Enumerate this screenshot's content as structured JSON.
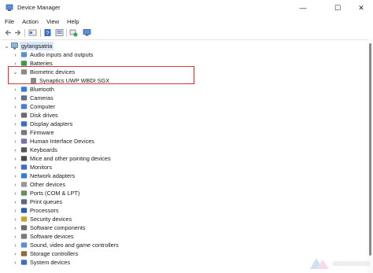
{
  "window": {
    "title": "Device Manager",
    "minimize_glyph": "—",
    "maximize_glyph": "☐",
    "close_glyph": "✕"
  },
  "menu": {
    "items": [
      "File",
      "Action",
      "View",
      "Help"
    ]
  },
  "toolbar": {
    "buttons": [
      "back-arrow-icon",
      "forward-arrow-icon",
      "properties-icon",
      "show-hidden-icon",
      "help-icon",
      "update-driver-icon",
      "scan-hardware-icon"
    ]
  },
  "tree": {
    "root": "gylangsatria",
    "selected_expanded": "Biometric devices",
    "child": "Synaptics UWP WBDI SGX",
    "categories": [
      "Audio inputs and outputs",
      "Batteries",
      "Biometric devices",
      "Bluetooth",
      "Cameras",
      "Computer",
      "Disk drives",
      "Display adapters",
      "Firmware",
      "Human Interface Devices",
      "Keyboards",
      "Mice and other pointing devices",
      "Monitors",
      "Network adapters",
      "Other devices",
      "Ports (COM & LPT)",
      "Print queues",
      "Processors",
      "Security devices",
      "Software components",
      "Software devices",
      "Sound, video and game controllers",
      "Storage controllers",
      "System devices"
    ]
  },
  "colors": {
    "highlight_border": "#d03a3a",
    "selection": "#d8e6f5"
  }
}
